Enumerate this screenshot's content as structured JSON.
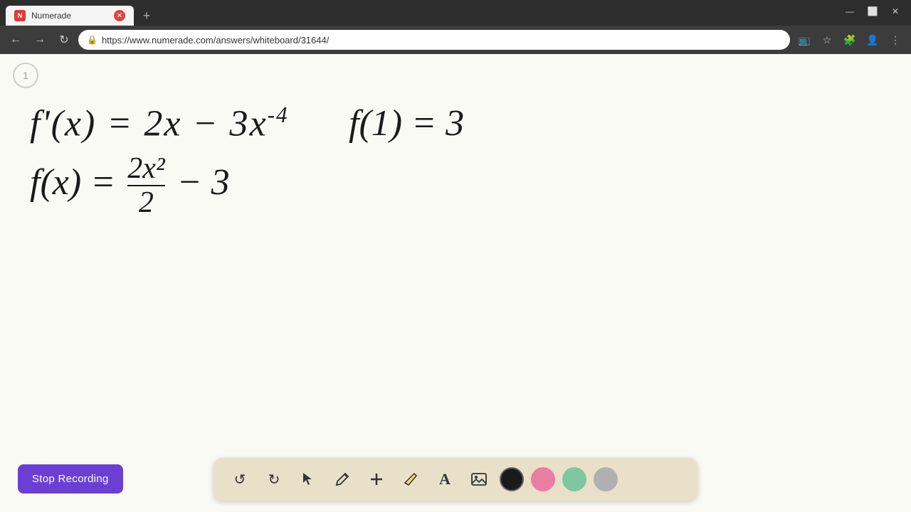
{
  "browser": {
    "tab_title": "Numerade",
    "tab_favicon": "N",
    "url": "https://www.numerade.com/answers/whiteboard/31644/",
    "new_tab_label": "+"
  },
  "window_controls": {
    "minimize": "—",
    "maximize": "⬜",
    "close": "✕"
  },
  "nav": {
    "back": "←",
    "forward": "→",
    "refresh": "↻",
    "lock_icon": "🔒"
  },
  "page": {
    "number": "1"
  },
  "math": {
    "line1": "f'(x) = 2x − 3x",
    "line1_exp": "-4",
    "condition": "f(1) = 3",
    "line2_prefix": "f(x) = ",
    "line2_frac_num": "2x²",
    "line2_frac_den": "2",
    "line2_suffix": "− 3"
  },
  "toolbar": {
    "undo_label": "↺",
    "redo_label": "↻",
    "select_label": "↖",
    "pen_label": "✏",
    "add_label": "+",
    "highlight_label": "⟋",
    "text_label": "A",
    "image_label": "🖼",
    "colors": [
      {
        "name": "black",
        "hex": "#1a1a1a",
        "selected": true
      },
      {
        "name": "pink",
        "hex": "#e87ea1"
      },
      {
        "name": "green",
        "hex": "#7ec8a0"
      },
      {
        "name": "gray",
        "hex": "#b0b0b0"
      }
    ]
  },
  "stop_recording": {
    "label": "Stop Recording"
  }
}
